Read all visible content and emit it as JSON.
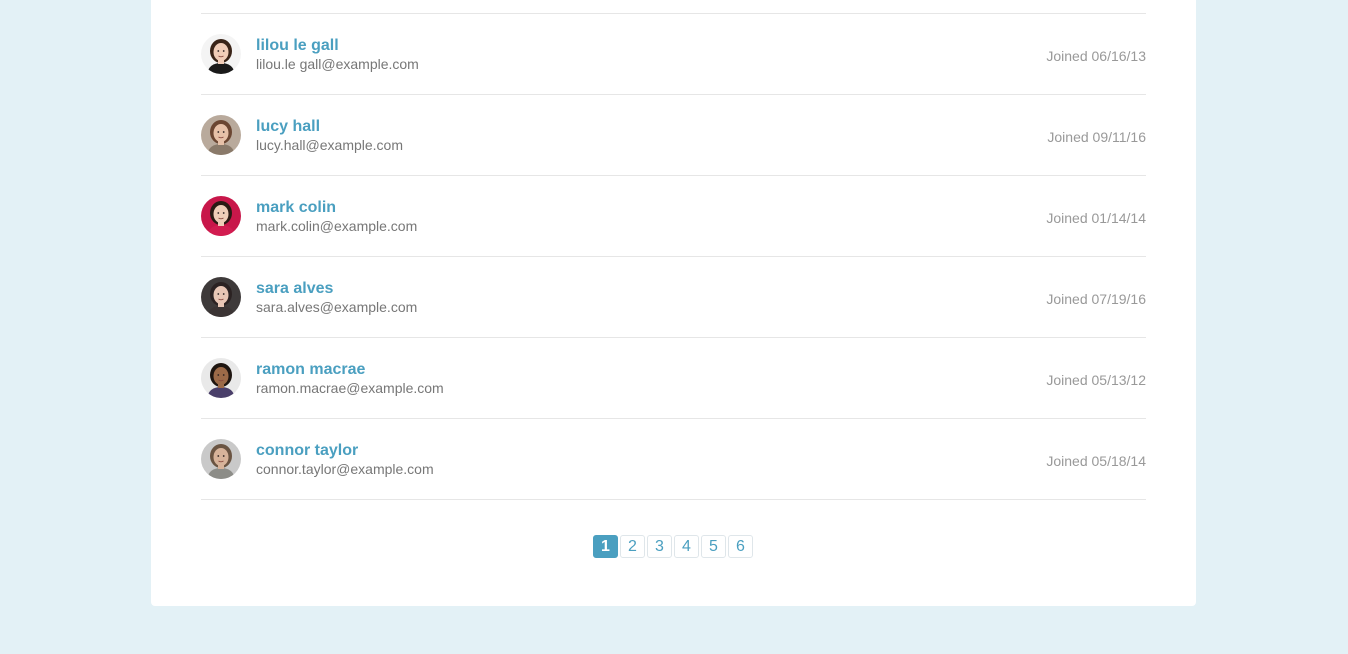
{
  "users": [
    {
      "name": "lilou le gall",
      "email": "lilou.le gall@example.com",
      "joined": "Joined 06/16/13",
      "avatar_icon": "avatar-woman-short-hair-icon",
      "bg": "#f4f4f4",
      "skin": "#f1cdb8",
      "hair": "#3a2418",
      "shirt": "#1a1a1a"
    },
    {
      "name": "lucy hall",
      "email": "lucy.hall@example.com",
      "joined": "Joined 09/11/16",
      "avatar_icon": "avatar-woman-long-hair-icon",
      "bg": "#b9aa9c",
      "skin": "#e7c1a8",
      "hair": "#6b4632",
      "shirt": "#8a7a6a"
    },
    {
      "name": "mark colin",
      "email": "mark.colin@example.com",
      "joined": "Joined 01/14/14",
      "avatar_icon": "avatar-woman-dark-hair-icon",
      "bg": "#c8174a",
      "skin": "#efcdb8",
      "hair": "#2a1a14",
      "shirt": "#d21c50"
    },
    {
      "name": "sara alves",
      "email": "sara.alves@example.com",
      "joined": "Joined 07/19/16",
      "avatar_icon": "avatar-woman-curly-hair-icon",
      "bg": "#3e3a3a",
      "skin": "#e8c6b5",
      "hair": "#2b2222",
      "shirt": "#3b3434"
    },
    {
      "name": "ramon macrae",
      "email": "ramon.macrae@example.com",
      "joined": "Joined 05/13/12",
      "avatar_icon": "avatar-man-icon",
      "bg": "#e9e9e9",
      "skin": "#9c6a48",
      "hair": "#1e1510",
      "shirt": "#4a3f6a"
    },
    {
      "name": "connor taylor",
      "email": "connor.taylor@example.com",
      "joined": "Joined 05/18/14",
      "avatar_icon": "avatar-man-glasses-icon",
      "bg": "#c9c9c9",
      "skin": "#d7b39a",
      "hair": "#6a5442",
      "shirt": "#8d8d88"
    }
  ],
  "pagination": {
    "pages": [
      "1",
      "2",
      "3",
      "4",
      "5",
      "6"
    ],
    "current": "1"
  },
  "colors": {
    "accent": "#4a9fc0",
    "background": "#e3f1f6",
    "card": "#ffffff"
  }
}
